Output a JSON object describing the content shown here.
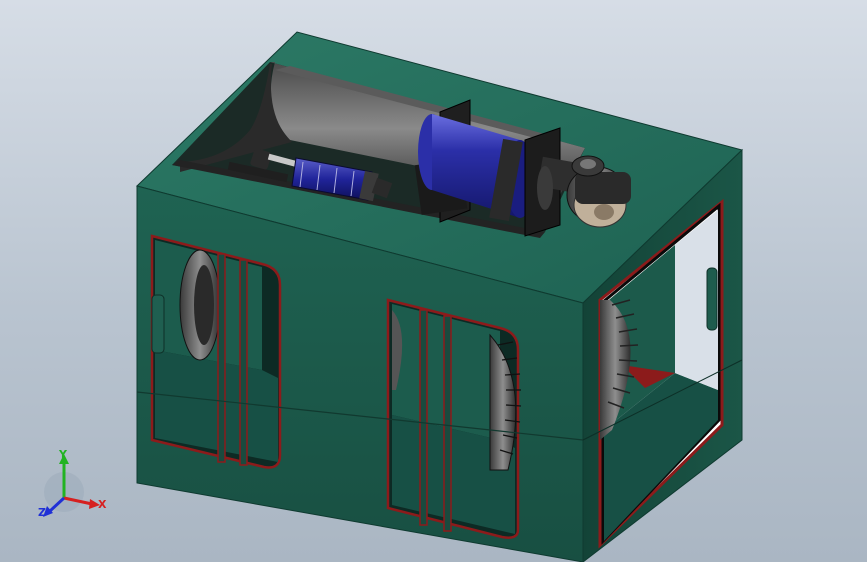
{
  "scene": {
    "description_free": true,
    "colors": {
      "background_top": "#d6dde6",
      "background_bottom": "#aab6c3",
      "frame_front": "#1d5c4d",
      "frame_top": "#2a7462",
      "frame_side": "#154a3e",
      "opening_edge": "#8c1b1b",
      "motor_blue": "#2b2fa8",
      "dark_metal": "#2a2a2a",
      "light_metal": "#b8b8b8"
    }
  },
  "triad": {
    "x_label": "X",
    "y_label": "Y",
    "z_label": "Z",
    "x_color": "#d62020",
    "y_color": "#22b322",
    "z_color": "#2030d6"
  }
}
